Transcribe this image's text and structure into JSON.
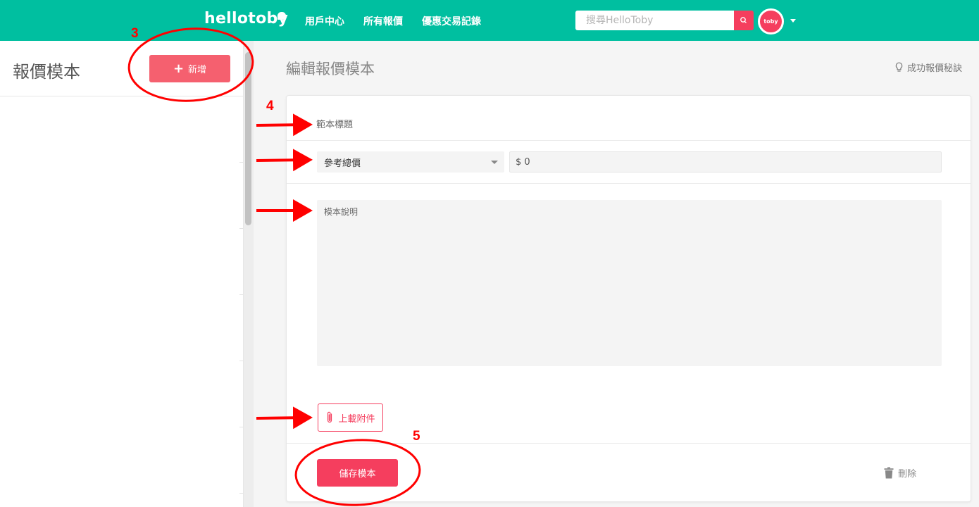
{
  "header": {
    "logo": "hellotoby",
    "nav": [
      "用戶中心",
      "所有報價",
      "優惠交易記錄"
    ],
    "search_placeholder": "搜尋HelloToby",
    "avatar_text": "toby",
    "brand_color": "#00bfa0",
    "accent_color": "#f53e5e"
  },
  "sidebar": {
    "title": "報價模本",
    "add_label": "新增"
  },
  "main": {
    "title": "編輯報價模本",
    "tips_label": "成功報價秘訣",
    "form": {
      "title_placeholder": "範本標題",
      "price_type_selected": "參考總價",
      "price_value": "$ 0",
      "description_placeholder": "模本說明",
      "upload_label": "上載附件",
      "save_label": "儲存模本",
      "delete_label": "刪除"
    }
  },
  "annotations": {
    "labels": [
      "3",
      "4",
      "5"
    ],
    "color": "#ff0000"
  }
}
